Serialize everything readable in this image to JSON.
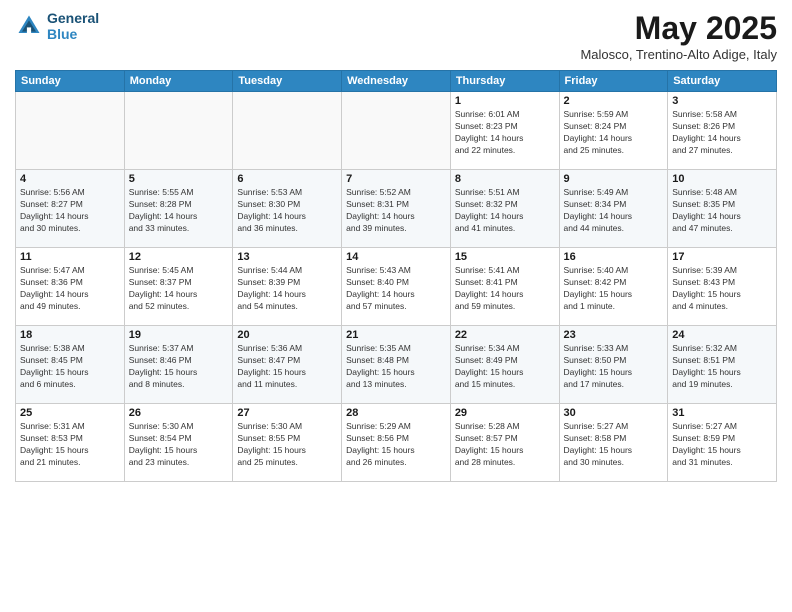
{
  "header": {
    "logo_line1": "General",
    "logo_line2": "Blue",
    "month": "May 2025",
    "location": "Malosco, Trentino-Alto Adige, Italy"
  },
  "weekdays": [
    "Sunday",
    "Monday",
    "Tuesday",
    "Wednesday",
    "Thursday",
    "Friday",
    "Saturday"
  ],
  "weeks": [
    [
      {
        "day": "",
        "info": ""
      },
      {
        "day": "",
        "info": ""
      },
      {
        "day": "",
        "info": ""
      },
      {
        "day": "",
        "info": ""
      },
      {
        "day": "1",
        "info": "Sunrise: 6:01 AM\nSunset: 8:23 PM\nDaylight: 14 hours\nand 22 minutes."
      },
      {
        "day": "2",
        "info": "Sunrise: 5:59 AM\nSunset: 8:24 PM\nDaylight: 14 hours\nand 25 minutes."
      },
      {
        "day": "3",
        "info": "Sunrise: 5:58 AM\nSunset: 8:26 PM\nDaylight: 14 hours\nand 27 minutes."
      }
    ],
    [
      {
        "day": "4",
        "info": "Sunrise: 5:56 AM\nSunset: 8:27 PM\nDaylight: 14 hours\nand 30 minutes."
      },
      {
        "day": "5",
        "info": "Sunrise: 5:55 AM\nSunset: 8:28 PM\nDaylight: 14 hours\nand 33 minutes."
      },
      {
        "day": "6",
        "info": "Sunrise: 5:53 AM\nSunset: 8:30 PM\nDaylight: 14 hours\nand 36 minutes."
      },
      {
        "day": "7",
        "info": "Sunrise: 5:52 AM\nSunset: 8:31 PM\nDaylight: 14 hours\nand 39 minutes."
      },
      {
        "day": "8",
        "info": "Sunrise: 5:51 AM\nSunset: 8:32 PM\nDaylight: 14 hours\nand 41 minutes."
      },
      {
        "day": "9",
        "info": "Sunrise: 5:49 AM\nSunset: 8:34 PM\nDaylight: 14 hours\nand 44 minutes."
      },
      {
        "day": "10",
        "info": "Sunrise: 5:48 AM\nSunset: 8:35 PM\nDaylight: 14 hours\nand 47 minutes."
      }
    ],
    [
      {
        "day": "11",
        "info": "Sunrise: 5:47 AM\nSunset: 8:36 PM\nDaylight: 14 hours\nand 49 minutes."
      },
      {
        "day": "12",
        "info": "Sunrise: 5:45 AM\nSunset: 8:37 PM\nDaylight: 14 hours\nand 52 minutes."
      },
      {
        "day": "13",
        "info": "Sunrise: 5:44 AM\nSunset: 8:39 PM\nDaylight: 14 hours\nand 54 minutes."
      },
      {
        "day": "14",
        "info": "Sunrise: 5:43 AM\nSunset: 8:40 PM\nDaylight: 14 hours\nand 57 minutes."
      },
      {
        "day": "15",
        "info": "Sunrise: 5:41 AM\nSunset: 8:41 PM\nDaylight: 14 hours\nand 59 minutes."
      },
      {
        "day": "16",
        "info": "Sunrise: 5:40 AM\nSunset: 8:42 PM\nDaylight: 15 hours\nand 1 minute."
      },
      {
        "day": "17",
        "info": "Sunrise: 5:39 AM\nSunset: 8:43 PM\nDaylight: 15 hours\nand 4 minutes."
      }
    ],
    [
      {
        "day": "18",
        "info": "Sunrise: 5:38 AM\nSunset: 8:45 PM\nDaylight: 15 hours\nand 6 minutes."
      },
      {
        "day": "19",
        "info": "Sunrise: 5:37 AM\nSunset: 8:46 PM\nDaylight: 15 hours\nand 8 minutes."
      },
      {
        "day": "20",
        "info": "Sunrise: 5:36 AM\nSunset: 8:47 PM\nDaylight: 15 hours\nand 11 minutes."
      },
      {
        "day": "21",
        "info": "Sunrise: 5:35 AM\nSunset: 8:48 PM\nDaylight: 15 hours\nand 13 minutes."
      },
      {
        "day": "22",
        "info": "Sunrise: 5:34 AM\nSunset: 8:49 PM\nDaylight: 15 hours\nand 15 minutes."
      },
      {
        "day": "23",
        "info": "Sunrise: 5:33 AM\nSunset: 8:50 PM\nDaylight: 15 hours\nand 17 minutes."
      },
      {
        "day": "24",
        "info": "Sunrise: 5:32 AM\nSunset: 8:51 PM\nDaylight: 15 hours\nand 19 minutes."
      }
    ],
    [
      {
        "day": "25",
        "info": "Sunrise: 5:31 AM\nSunset: 8:53 PM\nDaylight: 15 hours\nand 21 minutes."
      },
      {
        "day": "26",
        "info": "Sunrise: 5:30 AM\nSunset: 8:54 PM\nDaylight: 15 hours\nand 23 minutes."
      },
      {
        "day": "27",
        "info": "Sunrise: 5:30 AM\nSunset: 8:55 PM\nDaylight: 15 hours\nand 25 minutes."
      },
      {
        "day": "28",
        "info": "Sunrise: 5:29 AM\nSunset: 8:56 PM\nDaylight: 15 hours\nand 26 minutes."
      },
      {
        "day": "29",
        "info": "Sunrise: 5:28 AM\nSunset: 8:57 PM\nDaylight: 15 hours\nand 28 minutes."
      },
      {
        "day": "30",
        "info": "Sunrise: 5:27 AM\nSunset: 8:58 PM\nDaylight: 15 hours\nand 30 minutes."
      },
      {
        "day": "31",
        "info": "Sunrise: 5:27 AM\nSunset: 8:59 PM\nDaylight: 15 hours\nand 31 minutes."
      }
    ]
  ]
}
